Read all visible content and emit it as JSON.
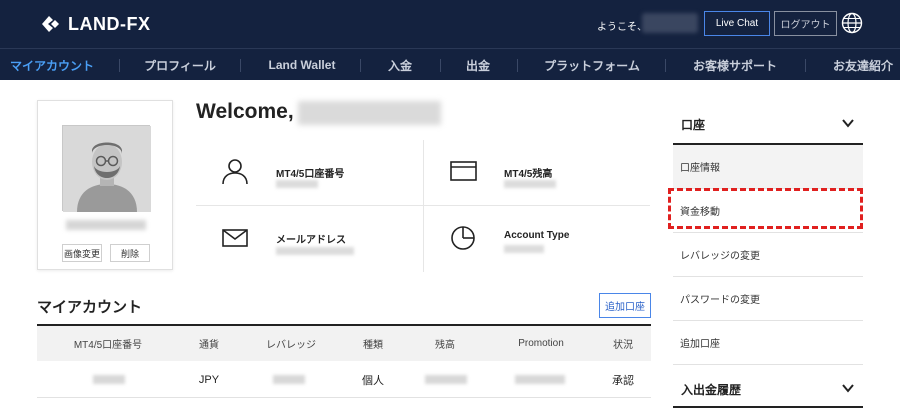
{
  "header": {
    "logo_text": "LAND-FX",
    "greeting": "ようこそ、",
    "live_chat_label": "Live Chat",
    "logout_label": "ログアウト",
    "language_icon": "globe-icon"
  },
  "nav": {
    "items": [
      {
        "label": "マイアカウント",
        "active": true
      },
      {
        "label": "プロフィール"
      },
      {
        "label": "Land Wallet"
      },
      {
        "label": "入金"
      },
      {
        "label": "出金"
      },
      {
        "label": "プラットフォーム"
      },
      {
        "label": "お客様サポート"
      },
      {
        "label": "お友達紹介"
      }
    ]
  },
  "profile": {
    "change_image_label": "画像変更",
    "delete_label": "削除"
  },
  "welcome": {
    "title": "Welcome,"
  },
  "info": {
    "account_number_label": "MT4/5口座番号",
    "balance_label": "MT4/5残高",
    "email_label": "メールアドレス",
    "account_type_label": "Account Type",
    "icons": [
      "user-icon",
      "wallet-icon",
      "mail-icon",
      "pie-chart-icon"
    ]
  },
  "my_account": {
    "title": "マイアカウント",
    "add_account_label": "追加口座",
    "columns": [
      "MT4/5口座番号",
      "通貨",
      "レバレッジ",
      "種類",
      "残高",
      "Promotion",
      "状況"
    ],
    "rows": [
      {
        "currency": "JPY",
        "type": "個人",
        "status": "承認"
      }
    ]
  },
  "sidebar": {
    "section1_label": "口座",
    "items": [
      {
        "label": "口座情報"
      },
      {
        "label": "資金移動"
      },
      {
        "label": "レバレッジの変更"
      },
      {
        "label": "パスワードの変更"
      },
      {
        "label": "追加口座"
      }
    ],
    "section2_label": "入出金履歴"
  },
  "colors": {
    "header_bg": "#14223f",
    "active_nav": "#4a9ff5",
    "accent_blue": "#4a86e8",
    "highlight_red": "#e0201f"
  }
}
